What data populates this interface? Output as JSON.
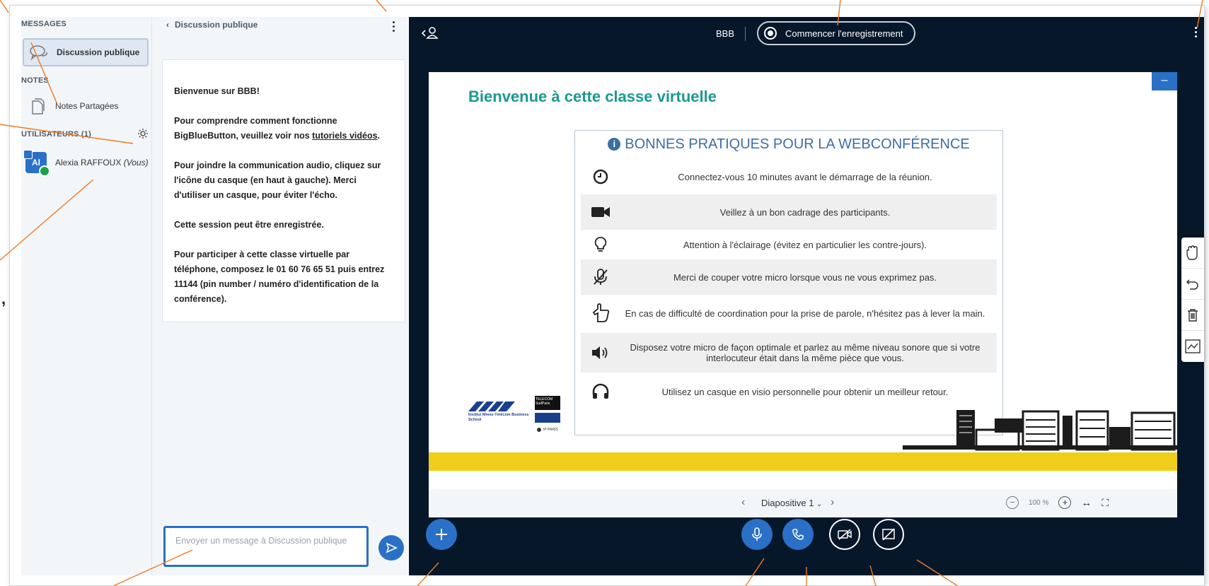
{
  "colors": {
    "accent": "#2a70c6",
    "dark_bg": "#06172a",
    "title_teal": "#1a9a8e",
    "annotation": "#f07a22",
    "band": "#f0cd1a"
  },
  "sidebar": {
    "messages_title": "MESSAGES",
    "public_chat_label": "Discussion publique",
    "notes_title": "NOTES",
    "shared_notes_label": "Notes Partagées",
    "users_title": "UTILISATEURS (1)",
    "user": {
      "initials": "Al",
      "name": "Alexia RAFFOUX",
      "you_suffix": "(Vous)"
    }
  },
  "chat": {
    "back_label": "Discussion publique",
    "welcome": "Bienvenue sur BBB!",
    "p2_before": "Pour comprendre comment fonctionne BigBlueButton, veuillez voir nos ",
    "p2_link": "tutoriels vidéos",
    "p2_after": ".",
    "p3": "Pour joindre la communication audio, cliquez sur l'icône du casque (en haut à gauche). Merci d'utiliser un casque, pour éviter l'écho.",
    "p4": "Cette session peut être enregistrée.",
    "p5": "Pour participer à cette classe virtuelle par téléphone, composez le 01 60 76 65 51 puis entrez 11144 (pin number / numéro d'identification de la conférence).",
    "input_placeholder": "Envoyer un message à Discussion publique"
  },
  "header": {
    "meeting_name": "BBB",
    "record_label": "Commencer l'enregistrement"
  },
  "slide": {
    "title": "Bienvenue à cette classe virtuelle",
    "table_title": "BONNES PRATIQUES POUR LA WEBCONFÉRENCE",
    "rows": [
      {
        "icon": "clock-icon",
        "text": "Connectez-vous 10 minutes avant le démarrage de la réunion."
      },
      {
        "icon": "video-camera-icon",
        "text": "Veillez à un bon cadrage des participants."
      },
      {
        "icon": "lightbulb-icon",
        "text": "Attention à l'éclairage (évitez en particulier les contre-jours)."
      },
      {
        "icon": "mic-off-icon",
        "text": "Merci de couper votre micro lorsque vous ne vous exprimez pas."
      },
      {
        "icon": "hand-pointer-icon",
        "text": "En cas de difficulté de coordination pour la prise de parole, n'hésitez pas à lever la main."
      },
      {
        "icon": "volume-icon",
        "text": "Disposez votre micro de façon optimale et parlez au même niveau sonore que si votre interlocuteur était dans la même pièce que vous."
      },
      {
        "icon": "headphones-icon",
        "text": "Utilisez un casque en visio personnelle pour obtenir un meilleur retour."
      }
    ],
    "logo_imt_text": "Institut Mines-Télécom Business School",
    "logo_telecom_text": "TELECOM SudParis",
    "logo_ip_text": "IP PARIS"
  },
  "slide_nav": {
    "slide_label": "Diapositive 1",
    "zoom": "100 %"
  }
}
